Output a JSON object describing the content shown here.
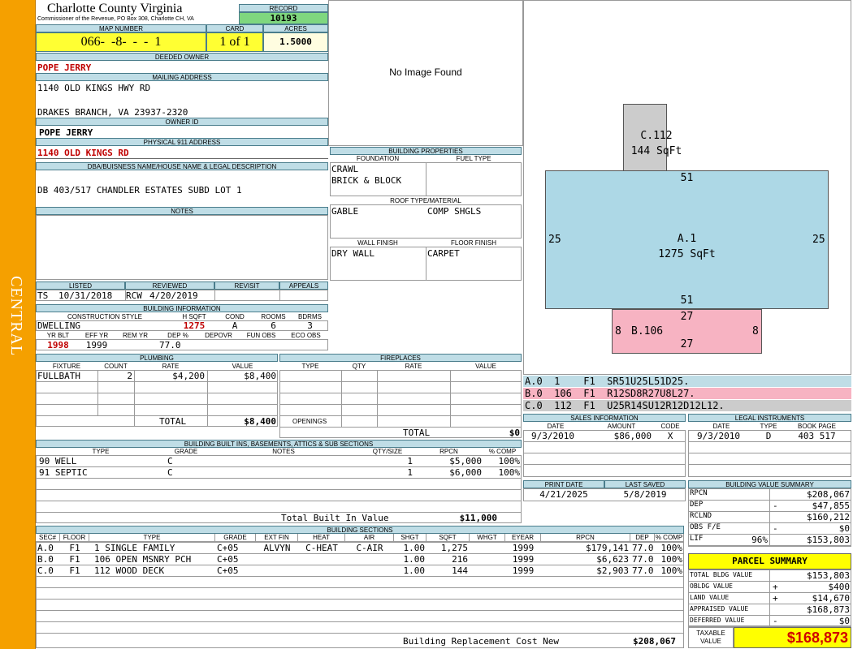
{
  "sidebar": {
    "label": "CENTRAL"
  },
  "header": {
    "county": "Charlotte County Virginia",
    "address": "Commissioner of the Revenue, PO Box 308, Charlotte CH, VA"
  },
  "record": {
    "label": "RECORD",
    "value": "10193"
  },
  "map": {
    "label": "MAP NUMBER",
    "value": "066-  -8-  -  -  1"
  },
  "card": {
    "label": "CARD",
    "value": "1 of 1"
  },
  "acres": {
    "label": "ACRES",
    "value": "1.5000"
  },
  "owner": {
    "label": "DEEDED OWNER",
    "value": "POPE JERRY"
  },
  "mailing": {
    "label": "MAILING ADDRESS",
    "line1": "1140 OLD KINGS HWY RD",
    "line2": "DRAKES BRANCH, VA 23937-2320"
  },
  "owner_id": {
    "label": "OWNER ID",
    "value": "POPE JERRY"
  },
  "physical": {
    "label": "PHYSICAL 911 ADDRESS",
    "value": "1140 OLD KINGS RD"
  },
  "dba": {
    "label": "DBA/BUISNESS NAME/HOUSE NAME & LEGAL DESCRIPTION",
    "value": "DB 403/517 CHANDLER ESTATES SUBD  LOT 1"
  },
  "notes": {
    "label": "NOTES"
  },
  "listing": {
    "listed_label": "LISTED",
    "reviewed_label": "REVIEWED",
    "revisit_label": "REVISIT",
    "appeals_label": "APPEALS",
    "listed_by": "TS",
    "listed_date": "10/31/2018",
    "reviewed_by": "RCW",
    "reviewed_date": "4/20/2019"
  },
  "building_info": {
    "label": "BUILDING INFORMATION",
    "h_construction": "CONSTRUCTION STYLE",
    "h_hsqft": "H SQFT",
    "h_cond": "COND",
    "h_rooms": "ROOMS",
    "h_bdrms": "BDRMS",
    "construction": "DWELLING",
    "hsqft": "1275",
    "cond": "A",
    "rooms": "6",
    "bdrms": "3",
    "h_yrblt": "YR BLT",
    "h_effyr": "EFF YR",
    "h_remyr": "REM YR",
    "h_dep": "DEP %",
    "h_depovr": "DEPOVR",
    "h_funobs": "FUN OBS",
    "h_ecoobs": "ECO OBS",
    "yrblt": "1998",
    "effyr": "1999",
    "dep": "77.0"
  },
  "image": {
    "text": "No Image Found"
  },
  "building_props": {
    "label": "BUILDING PROPERTIES",
    "foundation_label": "FOUNDATION",
    "fuel_label": "FUEL TYPE",
    "foundation1": "CRAWL",
    "foundation2": "BRICK & BLOCK",
    "roof_label": "ROOF TYPE/MATERIAL",
    "roof_type": "GABLE",
    "roof_material": "COMP SHGLS",
    "wall_label": "WALL FINISH",
    "floor_label": "FLOOR FINISH",
    "wall": "DRY WALL",
    "floor": "CARPET"
  },
  "sketch": {
    "a": {
      "name": "A.1",
      "area": "1275 SqFt",
      "top": "51",
      "bottom": "51",
      "left": "25",
      "right": "25"
    },
    "b": {
      "name": "B.106",
      "top": "27",
      "bottom": "27",
      "left": "8",
      "right": "8"
    },
    "c": {
      "name": "C.112",
      "area": "144 SqFt",
      "top": "51"
    }
  },
  "sketch_codes": [
    {
      "text": "A.0  1    F1  SR51U25L51D25.",
      "color": "#bfdde6"
    },
    {
      "text": "B.0  106  F1  R12SD8R27U8L27.",
      "color": "#f7b3c2"
    },
    {
      "text": "C.0  112  F1  U25R14SU12R12D12L12.",
      "color": "#cccccc"
    }
  ],
  "plumbing": {
    "label": "PLUMBING",
    "h_fixture": "FIXTURE",
    "h_count": "COUNT",
    "h_rate": "RATE",
    "h_value": "VALUE",
    "rows": [
      {
        "fixture": "FULLBATH",
        "count": "2",
        "rate": "$4,200",
        "value": "$8,400"
      }
    ],
    "total_label": "TOTAL",
    "total": "$8,400"
  },
  "fireplaces": {
    "label": "FIREPLACES",
    "h_type": "TYPE",
    "h_qty": "QTY",
    "h_rate": "RATE",
    "h_value": "VALUE",
    "openings": "OPENINGS",
    "total_label": "TOTAL",
    "total": "$0"
  },
  "sales": {
    "label": "SALES INFORMATION",
    "h_date": "DATE",
    "h_amount": "AMOUNT",
    "h_code": "CODE",
    "date": "9/3/2010",
    "amount": "$86,000",
    "code": "X"
  },
  "legal": {
    "label": "LEGAL INSTRUMENTS",
    "h_date": "DATE",
    "h_type": "TYPE",
    "h_book": "BOOK PAGE",
    "date": "9/3/2010",
    "type": "D",
    "book": "403 517"
  },
  "builtins": {
    "label": "BUILDING BUILT INS, BASEMENTS, ATTICS & SUB SECTIONS",
    "h_type": "TYPE",
    "h_grade": "GRADE",
    "h_notes": "NOTES",
    "h_qty": "QTY/SIZE",
    "h_rpcn": "RPCN",
    "h_comp": "% COMP",
    "rows": [
      {
        "type": "90 WELL",
        "grade": "C",
        "qty": "1",
        "rpcn": "$5,000",
        "comp": "100%"
      },
      {
        "type": "91 SEPTIC",
        "grade": "C",
        "qty": "1",
        "rpcn": "$6,000",
        "comp": "100%"
      }
    ],
    "total_label": "Total Built In Value",
    "total": "$11,000"
  },
  "print": {
    "print_label": "PRINT DATE",
    "saved_label": "LAST SAVED",
    "print_date": "4/21/2025",
    "saved_date": "5/8/2019"
  },
  "value_summary": {
    "label": "BUILDING VALUE SUMMARY",
    "rows": [
      {
        "label": "RPCN",
        "sign": "",
        "value": "$208,067"
      },
      {
        "label": "DEP",
        "sign": "-",
        "value": "$47,855"
      },
      {
        "label": "RCLND",
        "sign": "",
        "value": "$160,212"
      },
      {
        "label": "OBS F/E",
        "sign": "-",
        "value": "$0"
      },
      {
        "label": "LIF",
        "pct": "96%",
        "sign": "",
        "value": "$153,803"
      }
    ]
  },
  "sections": {
    "label": "BUILDING SECTIONS",
    "headers": [
      "SEC#",
      "FLOOR",
      "TYPE",
      "GRADE",
      "EXT FIN",
      "HEAT",
      "AIR",
      "SHGT",
      "SQFT",
      "WHGT",
      "EYEAR",
      "RPCN",
      "DEP",
      "% COMP"
    ],
    "rows": [
      [
        "A.0",
        "F1",
        "1 SINGLE FAMILY",
        "C+05",
        "ALVYN",
        "C-HEAT",
        "C-AIR",
        "1.00",
        "1,275",
        "",
        "1999",
        "$179,141",
        "77.0",
        "100%"
      ],
      [
        "B.0",
        "F1",
        "106 OPEN MSNRY PCH",
        "C+05",
        "",
        "",
        "",
        "1.00",
        "216",
        "",
        "1999",
        "$6,623",
        "77.0",
        "100%"
      ],
      [
        "C.0",
        "F1",
        "112 WOOD DECK",
        "C+05",
        "",
        "",
        "",
        "1.00",
        "144",
        "",
        "1999",
        "$2,903",
        "77.0",
        "100%"
      ]
    ],
    "total_label": "Building Replacement Cost New",
    "total": "$208,067"
  },
  "parcel": {
    "label": "PARCEL SUMMARY",
    "rows": [
      {
        "label": "TOTAL BLDG VALUE",
        "sign": "",
        "value": "$153,803"
      },
      {
        "label": "OBLDG VALUE",
        "sign": "+",
        "value": "$400"
      },
      {
        "label": "LAND VALUE",
        "sign": "+",
        "value": "$14,670"
      },
      {
        "label": "APPRAISED VALUE",
        "sign": "",
        "value": "$168,873"
      },
      {
        "label": "DEFERRED VALUE",
        "sign": "-",
        "value": "$0"
      }
    ],
    "taxable_label1": "TAXABLE",
    "taxable_label2": "VALUE",
    "taxable": "$168,873"
  }
}
